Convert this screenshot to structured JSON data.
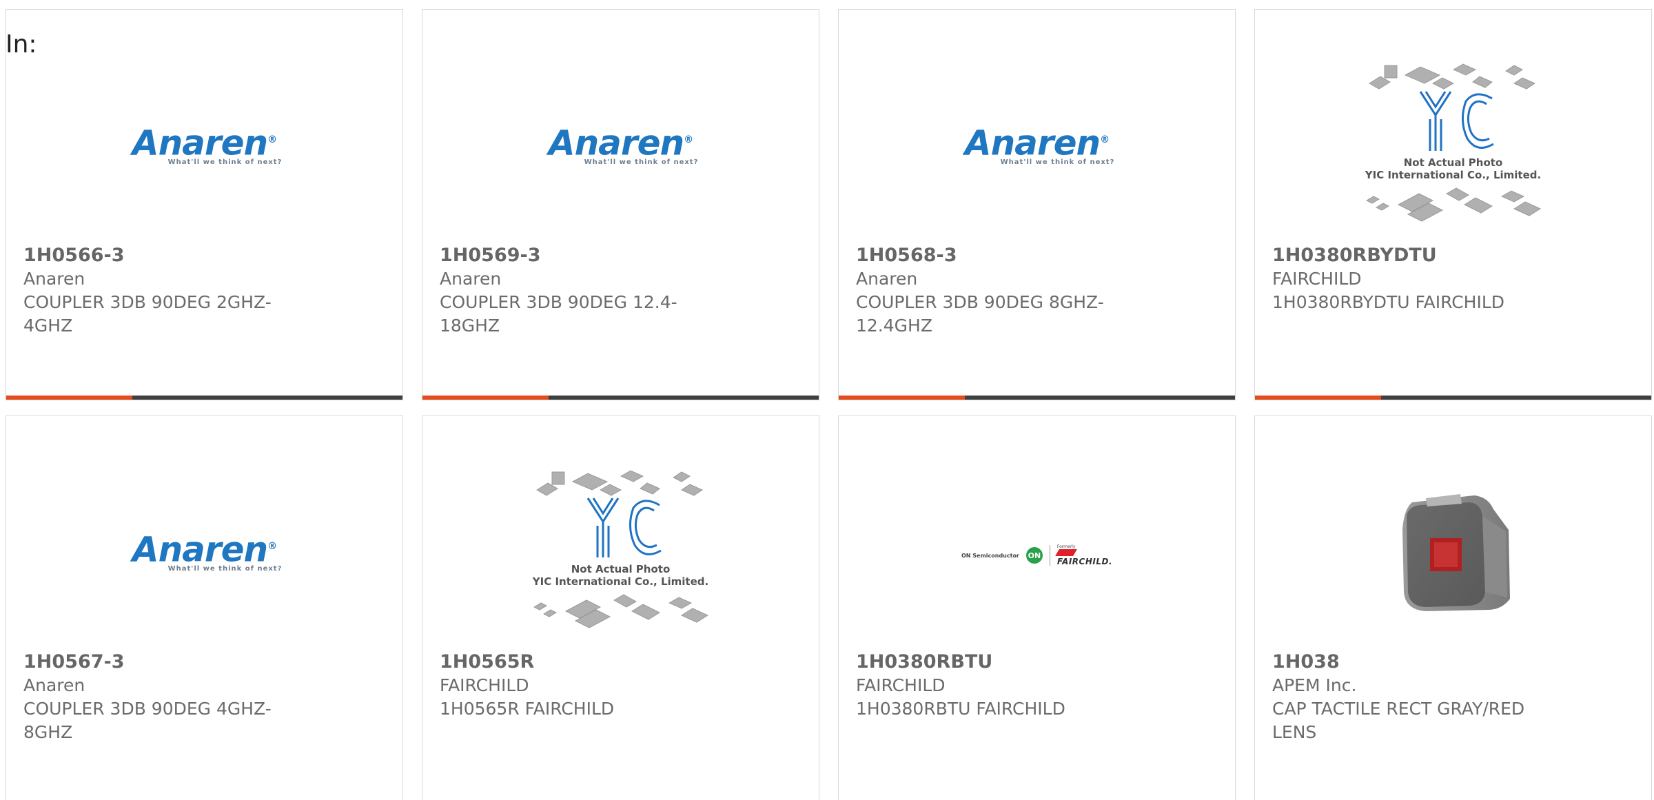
{
  "filter": {
    "label": "In:"
  },
  "products": [
    {
      "part_number": "1H0566-3",
      "manufacturer": "Anaren",
      "description_line1": "COUPLER 3DB 90DEG 2GHZ-",
      "description_line2": "4GHZ",
      "image": "anaren-logo",
      "logo_text": "Anaren",
      "logo_tagline": "What'll we think of next?"
    },
    {
      "part_number": "1H0569-3",
      "manufacturer": "Anaren",
      "description_line1": "COUPLER 3DB 90DEG 12.4-",
      "description_line2": "18GHZ",
      "image": "anaren-logo",
      "logo_text": "Anaren",
      "logo_tagline": "What'll we think of next?"
    },
    {
      "part_number": "1H0568-3",
      "manufacturer": "Anaren",
      "description_line1": "COUPLER 3DB 90DEG 8GHZ-",
      "description_line2": "12.4GHZ",
      "image": "anaren-logo",
      "logo_text": "Anaren",
      "logo_tagline": "What'll we think of next?"
    },
    {
      "part_number": "1H0380RBYDTU",
      "manufacturer": "FAIRCHILD",
      "description_line1": "1H0380RBYDTU FAIRCHILD",
      "description_line2": "",
      "image": "yic-placeholder",
      "logo_text": "YIC",
      "caption_line1": "Not Actual Photo",
      "caption_line2": "YIC International Co., Limited."
    },
    {
      "part_number": "1H0567-3",
      "manufacturer": "Anaren",
      "description_line1": "COUPLER 3DB 90DEG 4GHZ-",
      "description_line2": "8GHZ",
      "image": "anaren-logo",
      "logo_text": "Anaren",
      "logo_tagline": "What'll we think of next?"
    },
    {
      "part_number": "1H0565R",
      "manufacturer": "FAIRCHILD",
      "description_line1": "1H0565R FAIRCHILD",
      "description_line2": "",
      "image": "yic-placeholder",
      "logo_text": "YIC",
      "caption_line1": "Not Actual Photo",
      "caption_line2": "YIC International Co., Limited."
    },
    {
      "part_number": "1H0380RBTU",
      "manufacturer": "FAIRCHILD",
      "description_line1": "1H0380RBTU FAIRCHILD",
      "description_line2": "",
      "image": "fairchild-logo",
      "logo_onsemi": "ON Semiconductor",
      "logo_on": "ON",
      "logo_formerly": "Formerly",
      "logo_fairchild": "FAIRCHILD."
    },
    {
      "part_number": "1H038",
      "manufacturer": "APEM Inc.",
      "description_line1": "CAP TACTILE RECT GRAY/RED",
      "description_line2": "LENS",
      "image": "tactile-cap-photo"
    }
  ],
  "colors": {
    "accent_bar": "#e34a1c",
    "dark_bar": "#3f3f3f",
    "anaren_blue": "#1e77c0",
    "yic_blue": "#1f72c4",
    "card_border": "#d8d8d8",
    "text_gray": "#666666"
  }
}
